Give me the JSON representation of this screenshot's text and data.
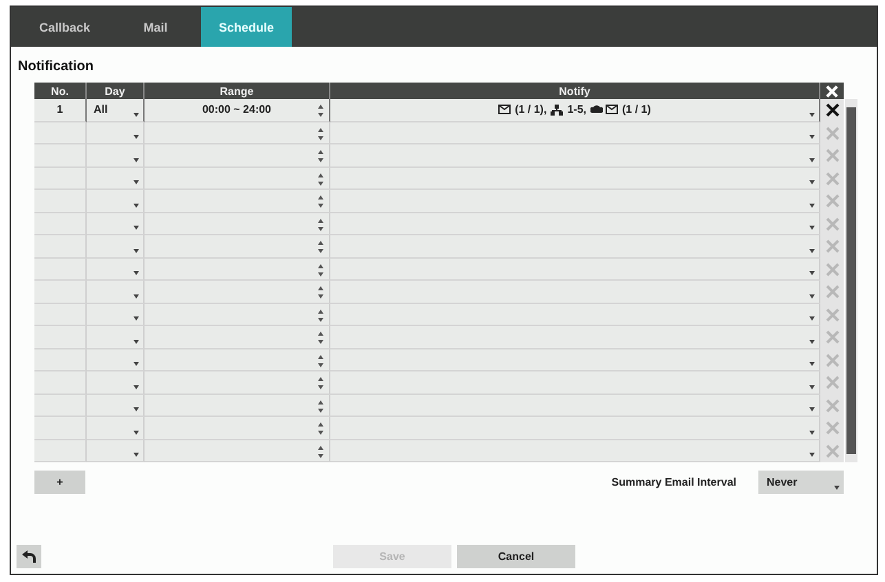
{
  "tabs": [
    {
      "label": "Callback",
      "selected": false
    },
    {
      "label": "Mail",
      "selected": false
    },
    {
      "label": "Schedule",
      "selected": true
    }
  ],
  "section_title": "Notification",
  "table": {
    "columns": [
      "No.",
      "Day",
      "Range",
      "Notify"
    ],
    "rows": [
      {
        "delete_enabled": true,
        "no": "1",
        "day": "All",
        "range": "00:00 ~ 24:00",
        "notify": [
          {
            "kind": "mail",
            "text": "(1 / 1),"
          },
          {
            "kind": "network",
            "text": "1-5,"
          },
          {
            "kind": "cloud_mail",
            "text": "(1 / 1)"
          }
        ]
      },
      {
        "delete_enabled": false
      },
      {
        "delete_enabled": false
      },
      {
        "delete_enabled": false
      },
      {
        "delete_enabled": false
      },
      {
        "delete_enabled": false
      },
      {
        "delete_enabled": false
      },
      {
        "delete_enabled": false
      },
      {
        "delete_enabled": false
      },
      {
        "delete_enabled": false
      },
      {
        "delete_enabled": false
      },
      {
        "delete_enabled": false
      },
      {
        "delete_enabled": false
      },
      {
        "delete_enabled": false
      },
      {
        "delete_enabled": false
      },
      {
        "delete_enabled": false
      }
    ]
  },
  "add_button": "+",
  "summary_label": "Summary Email Interval",
  "summary_value": "Never",
  "buttons": [
    {
      "label": "Save",
      "disabled": true
    },
    {
      "label": "Cancel",
      "disabled": false
    }
  ]
}
